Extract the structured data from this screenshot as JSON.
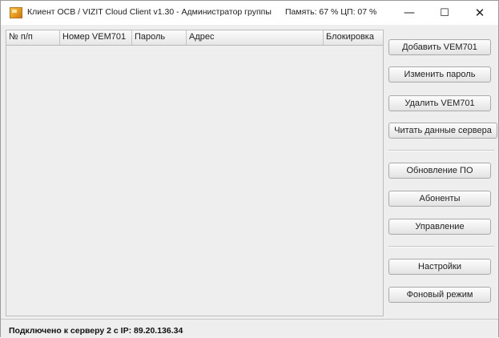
{
  "window": {
    "title": "Клиент ОСВ / VIZIT Cloud Client v1.30 - Администратор группы",
    "stats": "Память: 67 %  ЦП: 07 %",
    "controls": {
      "minimize": "—",
      "maximize": "☐",
      "close": "✕"
    }
  },
  "table": {
    "columns": [
      "№ п/п",
      "Номер VEM701",
      "Пароль",
      "Адрес",
      "Блокировка"
    ],
    "rows": []
  },
  "side_panel": {
    "buttons": [
      "Добавить VEM701",
      "Изменить пароль",
      "Удалить VEM701",
      "Читать данные сервера",
      "Обновление ПО",
      "Абоненты",
      "Управление",
      "Настройки",
      "Фоновый режим"
    ]
  },
  "status_bar": {
    "text": "Подключено к серверу 2 с IP:  89.20.136.34"
  }
}
